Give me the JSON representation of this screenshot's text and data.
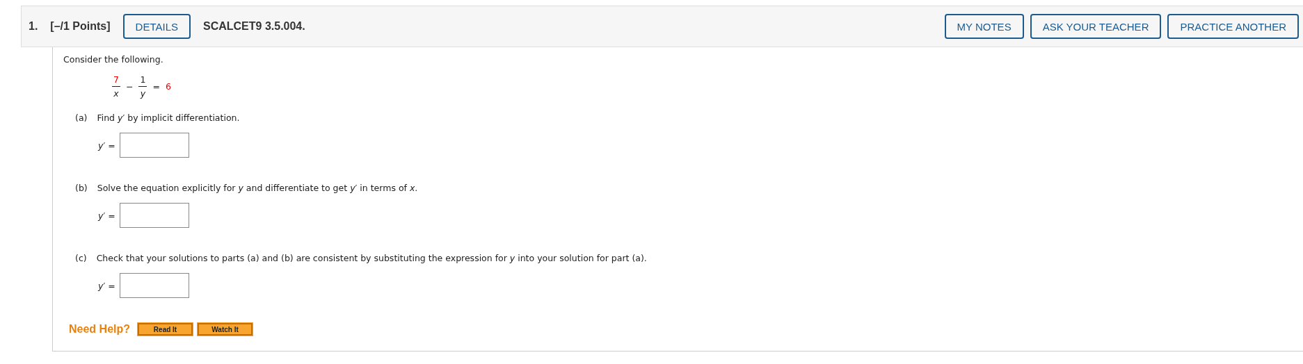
{
  "header": {
    "number": "1.",
    "points": "[–/1 Points]",
    "details_button": "DETAILS",
    "code": "SCALCET9 3.5.004.",
    "buttons": [
      "MY NOTES",
      "ASK YOUR TEACHER",
      "PRACTICE ANOTHER"
    ]
  },
  "intro": "Consider the following.",
  "equation": {
    "term_1": {
      "numerator": "7",
      "denominator": "x"
    },
    "operator": "−",
    "term_2": {
      "numerator": "1",
      "denominator": "y"
    },
    "equals": "=",
    "rhs": "6"
  },
  "parts": [
    {
      "label": "(a)",
      "text": "Find *y*′ by implicit differentiation.",
      "answer_label": "*y*′ ="
    },
    {
      "label": "(b)",
      "text": "Solve the equation explicitly for *y* and differentiate to get *y*′ in terms of *x*.",
      "answer_label": "*y*′ ="
    },
    {
      "label": "(c)",
      "text": "Check that your solutions to parts (a) and (b) are consistent by substituting the expression for *y* into your solution for part (a).",
      "answer_label": "*y*′ ="
    }
  ],
  "help": {
    "label": "Need Help?",
    "buttons": [
      "Read It",
      "Watch It"
    ]
  }
}
